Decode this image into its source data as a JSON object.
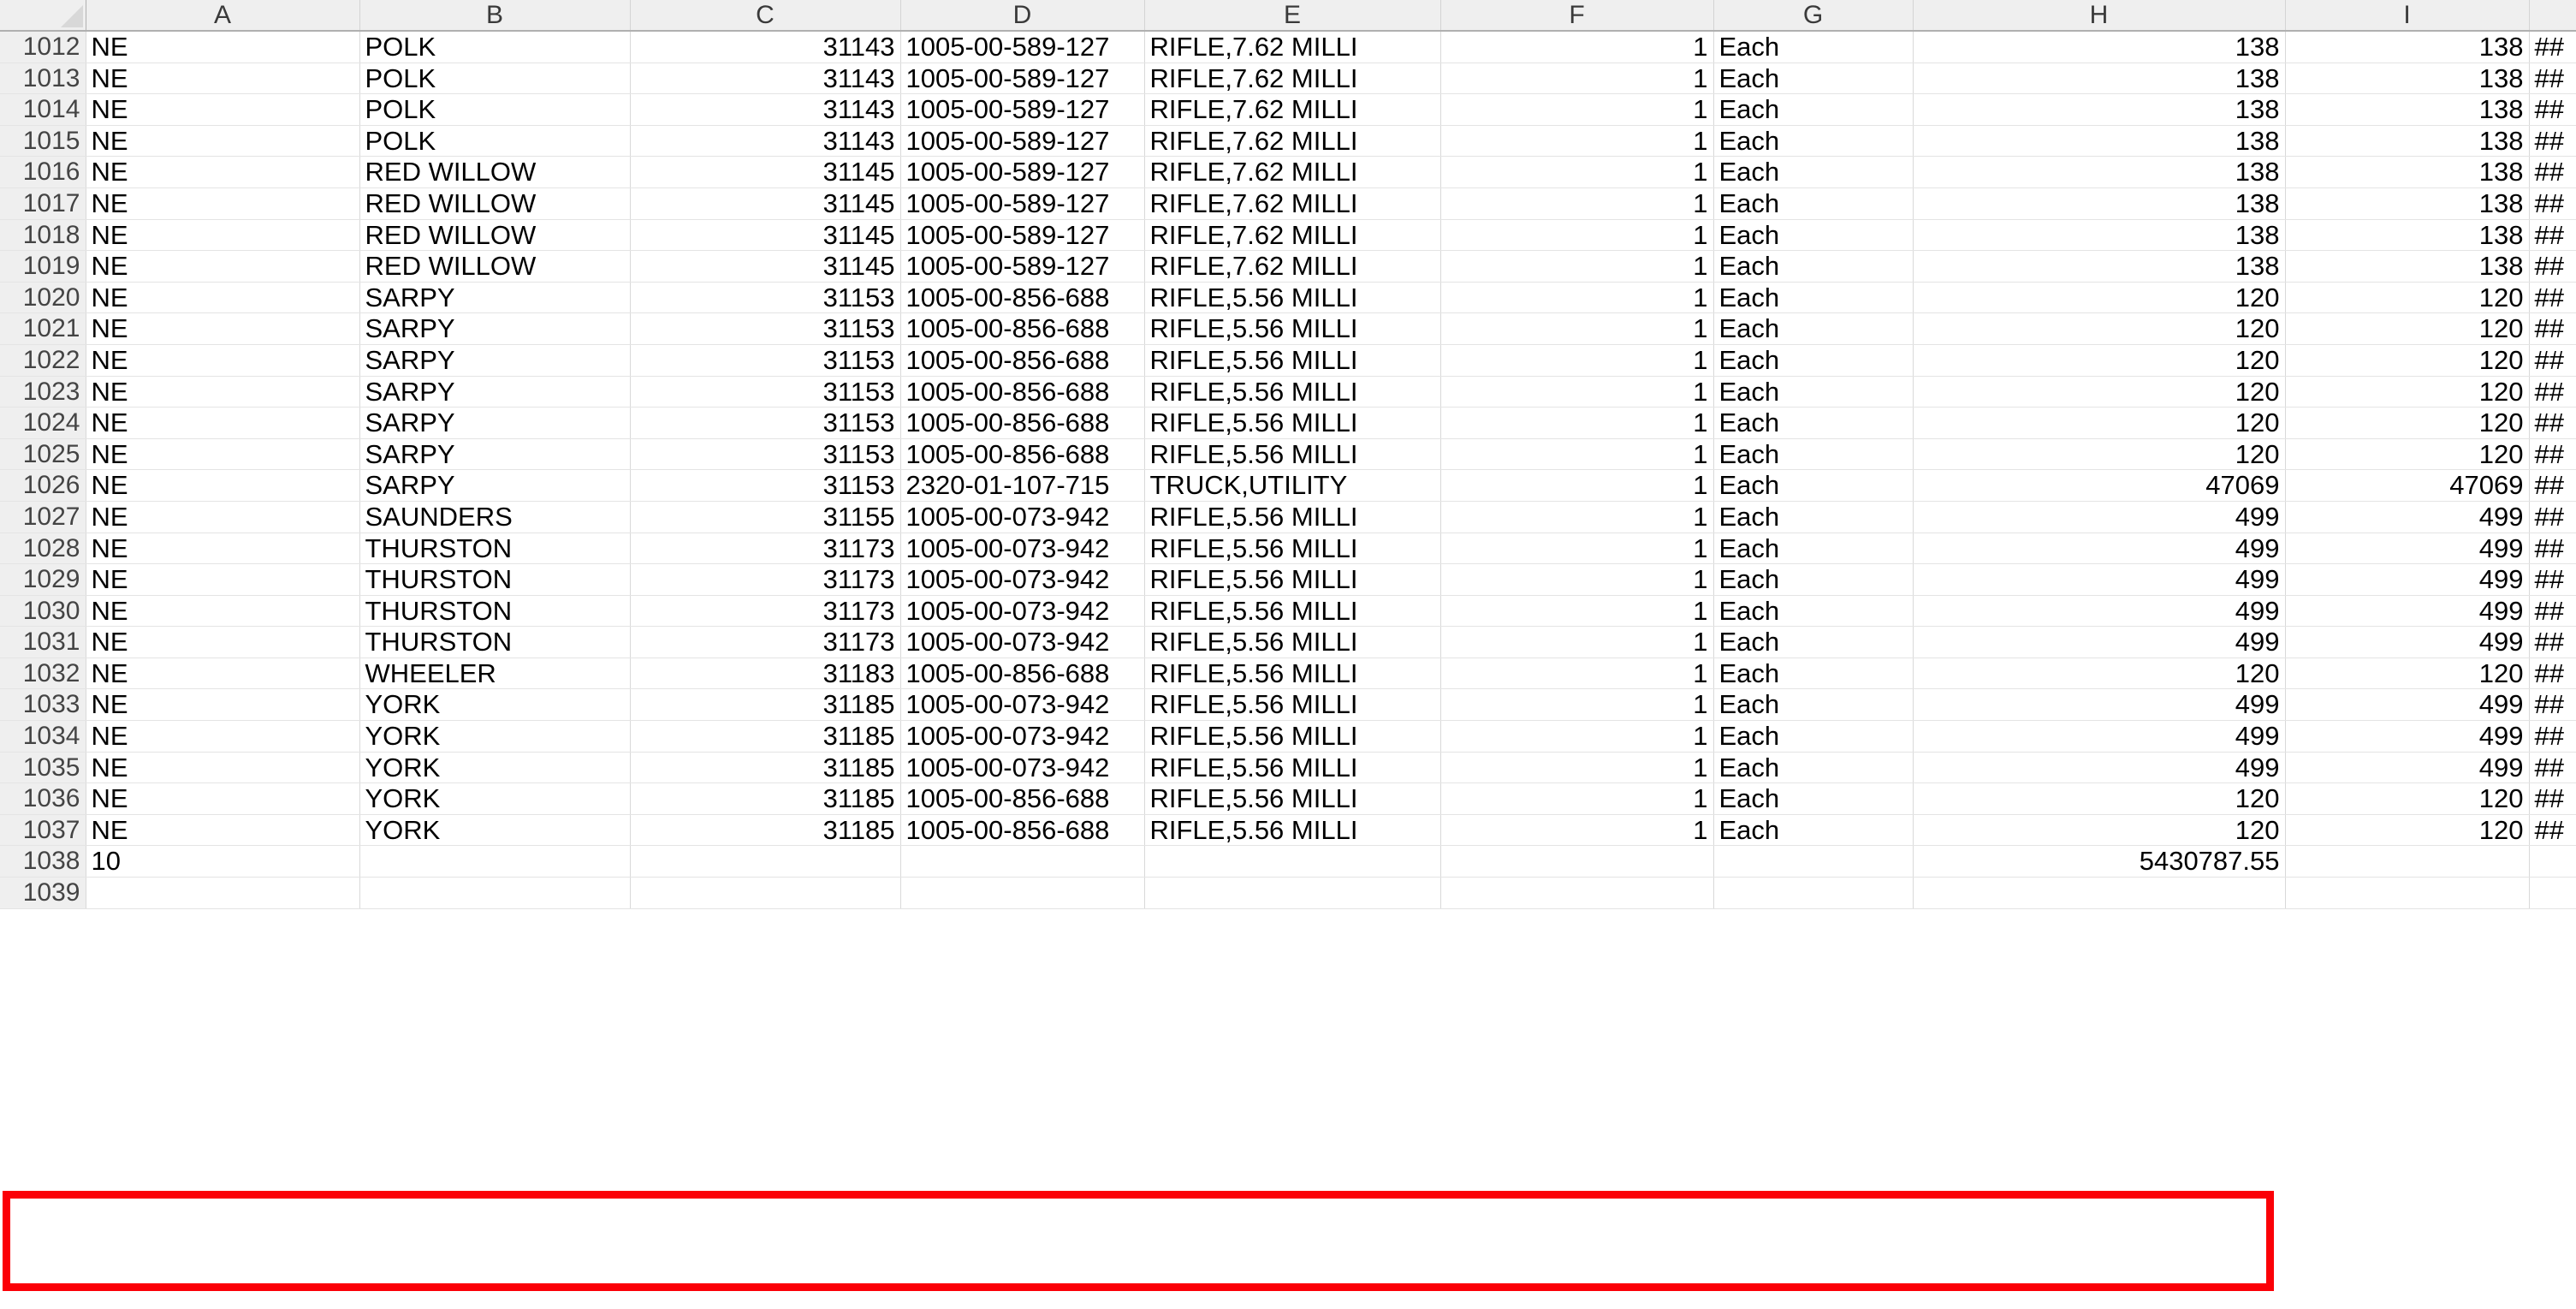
{
  "spreadsheet": {
    "corner_label": "select-all",
    "column_headers": [
      "A",
      "B",
      "C",
      "D",
      "E",
      "F",
      "G",
      "H",
      "I"
    ],
    "overflow_marker": "##",
    "highlight_color": "#fb0007",
    "rows": [
      {
        "num": "1012",
        "a": "NE",
        "b": "POLK",
        "c": "31143",
        "d": "1005-00-589-127",
        "e": "RIFLE,7.62 MILLI",
        "f": "1",
        "g": "Each",
        "h": "138",
        "i": "138",
        "j": "##"
      },
      {
        "num": "1013",
        "a": "NE",
        "b": "POLK",
        "c": "31143",
        "d": "1005-00-589-127",
        "e": "RIFLE,7.62 MILLI",
        "f": "1",
        "g": "Each",
        "h": "138",
        "i": "138",
        "j": "##"
      },
      {
        "num": "1014",
        "a": "NE",
        "b": "POLK",
        "c": "31143",
        "d": "1005-00-589-127",
        "e": "RIFLE,7.62 MILLI",
        "f": "1",
        "g": "Each",
        "h": "138",
        "i": "138",
        "j": "##"
      },
      {
        "num": "1015",
        "a": "NE",
        "b": "POLK",
        "c": "31143",
        "d": "1005-00-589-127",
        "e": "RIFLE,7.62 MILLI",
        "f": "1",
        "g": "Each",
        "h": "138",
        "i": "138",
        "j": "##"
      },
      {
        "num": "1016",
        "a": "NE",
        "b": "RED WILLOW",
        "c": "31145",
        "d": "1005-00-589-127",
        "e": "RIFLE,7.62 MILLI",
        "f": "1",
        "g": "Each",
        "h": "138",
        "i": "138",
        "j": "##"
      },
      {
        "num": "1017",
        "a": "NE",
        "b": "RED WILLOW",
        "c": "31145",
        "d": "1005-00-589-127",
        "e": "RIFLE,7.62 MILLI",
        "f": "1",
        "g": "Each",
        "h": "138",
        "i": "138",
        "j": "##"
      },
      {
        "num": "1018",
        "a": "NE",
        "b": "RED WILLOW",
        "c": "31145",
        "d": "1005-00-589-127",
        "e": "RIFLE,7.62 MILLI",
        "f": "1",
        "g": "Each",
        "h": "138",
        "i": "138",
        "j": "##"
      },
      {
        "num": "1019",
        "a": "NE",
        "b": "RED WILLOW",
        "c": "31145",
        "d": "1005-00-589-127",
        "e": "RIFLE,7.62 MILLI",
        "f": "1",
        "g": "Each",
        "h": "138",
        "i": "138",
        "j": "##"
      },
      {
        "num": "1020",
        "a": "NE",
        "b": "SARPY",
        "c": "31153",
        "d": "1005-00-856-688",
        "e": "RIFLE,5.56 MILLI",
        "f": "1",
        "g": "Each",
        "h": "120",
        "i": "120",
        "j": "##"
      },
      {
        "num": "1021",
        "a": "NE",
        "b": "SARPY",
        "c": "31153",
        "d": "1005-00-856-688",
        "e": "RIFLE,5.56 MILLI",
        "f": "1",
        "g": "Each",
        "h": "120",
        "i": "120",
        "j": "##"
      },
      {
        "num": "1022",
        "a": "NE",
        "b": "SARPY",
        "c": "31153",
        "d": "1005-00-856-688",
        "e": "RIFLE,5.56 MILLI",
        "f": "1",
        "g": "Each",
        "h": "120",
        "i": "120",
        "j": "##"
      },
      {
        "num": "1023",
        "a": "NE",
        "b": "SARPY",
        "c": "31153",
        "d": "1005-00-856-688",
        "e": "RIFLE,5.56 MILLI",
        "f": "1",
        "g": "Each",
        "h": "120",
        "i": "120",
        "j": "##"
      },
      {
        "num": "1024",
        "a": "NE",
        "b": "SARPY",
        "c": "31153",
        "d": "1005-00-856-688",
        "e": "RIFLE,5.56 MILLI",
        "f": "1",
        "g": "Each",
        "h": "120",
        "i": "120",
        "j": "##"
      },
      {
        "num": "1025",
        "a": "NE",
        "b": "SARPY",
        "c": "31153",
        "d": "1005-00-856-688",
        "e": "RIFLE,5.56 MILLI",
        "f": "1",
        "g": "Each",
        "h": "120",
        "i": "120",
        "j": "##"
      },
      {
        "num": "1026",
        "a": "NE",
        "b": "SARPY",
        "c": "31153",
        "d": "2320-01-107-715",
        "e": "TRUCK,UTILITY",
        "f": "1",
        "g": "Each",
        "h": "47069",
        "i": "47069",
        "j": "##"
      },
      {
        "num": "1027",
        "a": "NE",
        "b": "SAUNDERS",
        "c": "31155",
        "d": "1005-00-073-942",
        "e": "RIFLE,5.56 MILLI",
        "f": "1",
        "g": "Each",
        "h": "499",
        "i": "499",
        "j": "##"
      },
      {
        "num": "1028",
        "a": "NE",
        "b": "THURSTON",
        "c": "31173",
        "d": "1005-00-073-942",
        "e": "RIFLE,5.56 MILLI",
        "f": "1",
        "g": "Each",
        "h": "499",
        "i": "499",
        "j": "##"
      },
      {
        "num": "1029",
        "a": "NE",
        "b": "THURSTON",
        "c": "31173",
        "d": "1005-00-073-942",
        "e": "RIFLE,5.56 MILLI",
        "f": "1",
        "g": "Each",
        "h": "499",
        "i": "499",
        "j": "##"
      },
      {
        "num": "1030",
        "a": "NE",
        "b": "THURSTON",
        "c": "31173",
        "d": "1005-00-073-942",
        "e": "RIFLE,5.56 MILLI",
        "f": "1",
        "g": "Each",
        "h": "499",
        "i": "499",
        "j": "##"
      },
      {
        "num": "1031",
        "a": "NE",
        "b": "THURSTON",
        "c": "31173",
        "d": "1005-00-073-942",
        "e": "RIFLE,5.56 MILLI",
        "f": "1",
        "g": "Each",
        "h": "499",
        "i": "499",
        "j": "##"
      },
      {
        "num": "1032",
        "a": "NE",
        "b": "WHEELER",
        "c": "31183",
        "d": "1005-00-856-688",
        "e": "RIFLE,5.56 MILLI",
        "f": "1",
        "g": "Each",
        "h": "120",
        "i": "120",
        "j": "##"
      },
      {
        "num": "1033",
        "a": "NE",
        "b": "YORK",
        "c": "31185",
        "d": "1005-00-073-942",
        "e": "RIFLE,5.56 MILLI",
        "f": "1",
        "g": "Each",
        "h": "499",
        "i": "499",
        "j": "##"
      },
      {
        "num": "1034",
        "a": "NE",
        "b": "YORK",
        "c": "31185",
        "d": "1005-00-073-942",
        "e": "RIFLE,5.56 MILLI",
        "f": "1",
        "g": "Each",
        "h": "499",
        "i": "499",
        "j": "##"
      },
      {
        "num": "1035",
        "a": "NE",
        "b": "YORK",
        "c": "31185",
        "d": "1005-00-073-942",
        "e": "RIFLE,5.56 MILLI",
        "f": "1",
        "g": "Each",
        "h": "499",
        "i": "499",
        "j": "##"
      },
      {
        "num": "1036",
        "a": "NE",
        "b": "YORK",
        "c": "31185",
        "d": "1005-00-856-688",
        "e": "RIFLE,5.56 MILLI",
        "f": "1",
        "g": "Each",
        "h": "120",
        "i": "120",
        "j": "##"
      },
      {
        "num": "1037",
        "a": "NE",
        "b": "YORK",
        "c": "31185",
        "d": "1005-00-856-688",
        "e": "RIFLE,5.56 MILLI",
        "f": "1",
        "g": "Each",
        "h": "120",
        "i": "120",
        "j": "##"
      },
      {
        "num": "1038",
        "a": "10",
        "b": "",
        "c": "",
        "d": "",
        "e": "",
        "f": "",
        "g": "",
        "h": "5430787.55",
        "i": "",
        "j": ""
      },
      {
        "num": "1039",
        "a": "",
        "b": "",
        "c": "",
        "d": "",
        "e": "",
        "f": "",
        "g": "",
        "h": "",
        "i": "",
        "j": ""
      }
    ]
  }
}
